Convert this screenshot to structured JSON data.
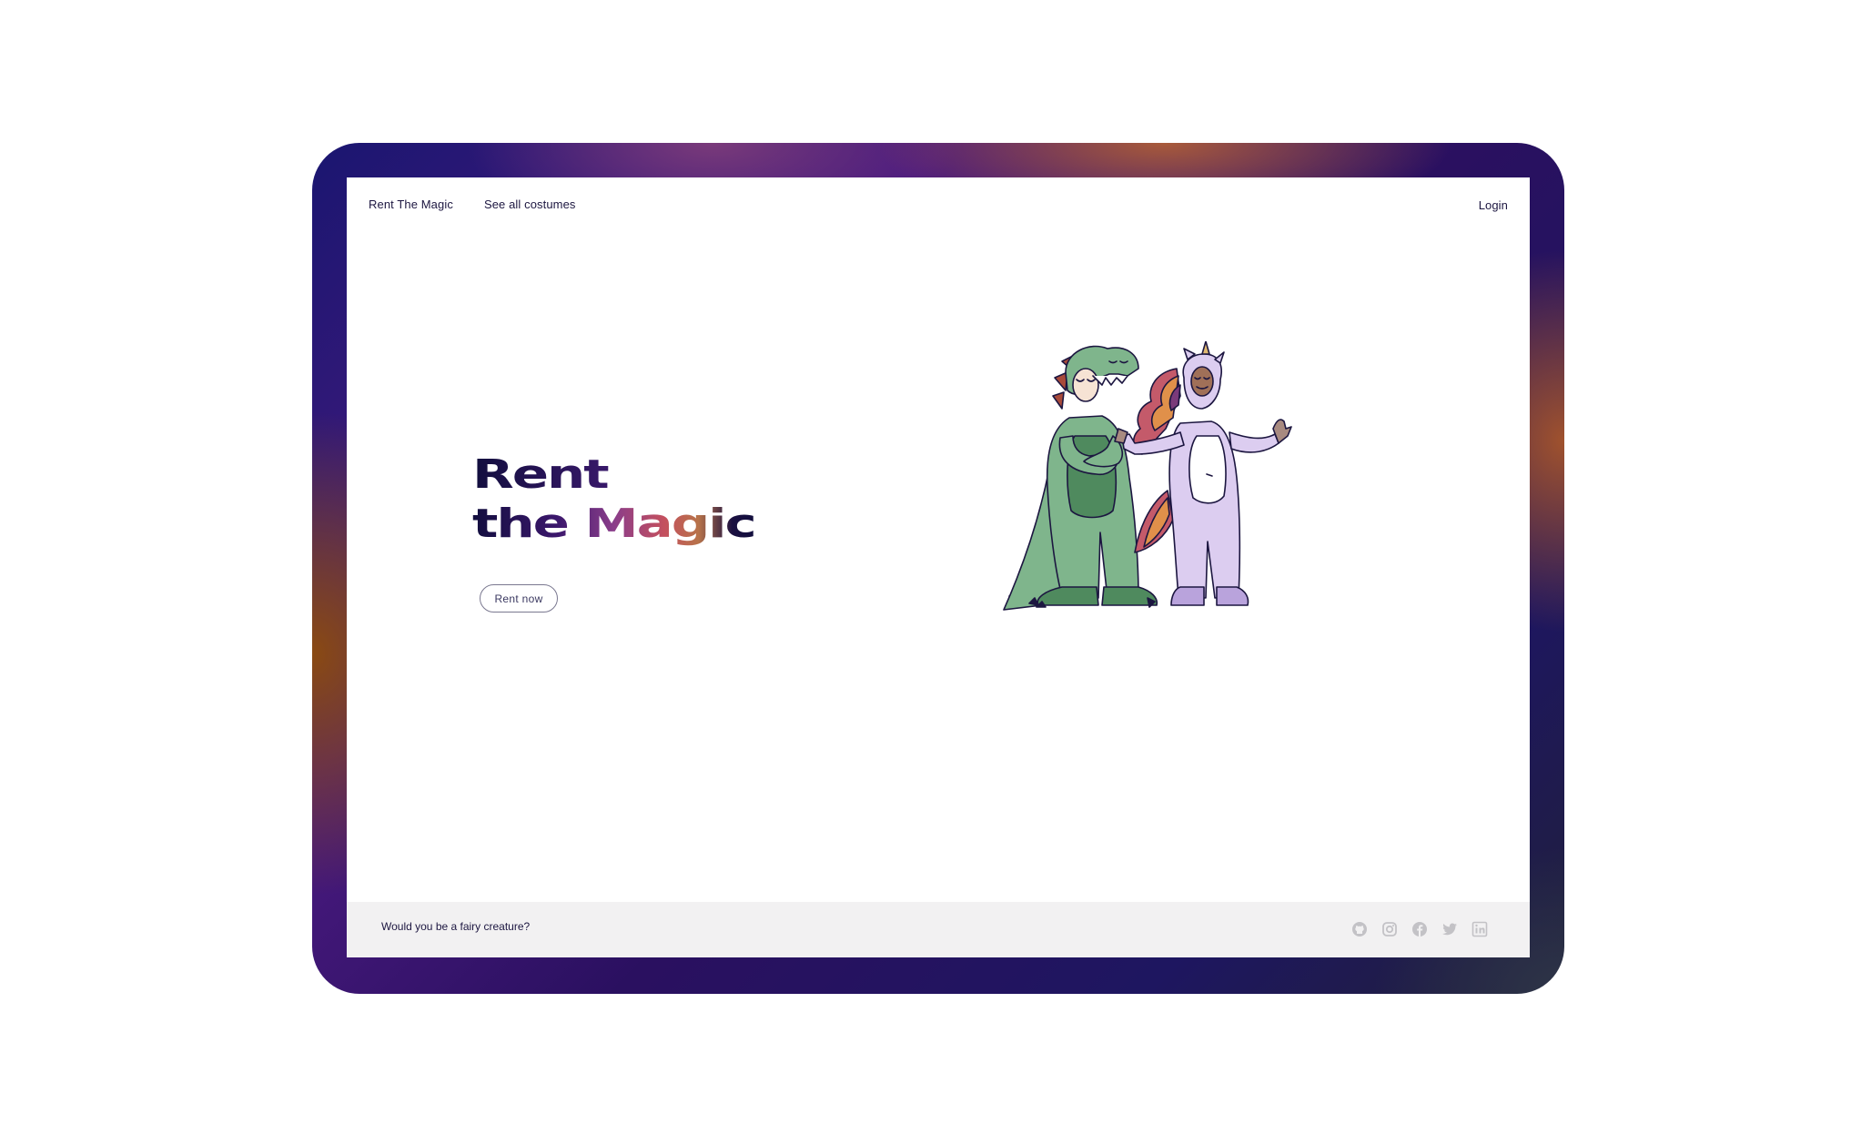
{
  "nav": {
    "brand": "Rent The Magic",
    "costumes_link": "See all costumes",
    "login": "Login"
  },
  "hero": {
    "line1": "Rent",
    "line2": "the Magic",
    "cta": "Rent now"
  },
  "footer": {
    "tagline": "Would you be a fairy creature?",
    "social_icons": [
      "github-icon",
      "instagram-icon",
      "facebook-icon",
      "twitter-icon",
      "linkedin-icon"
    ]
  },
  "colors": {
    "text_dark": "#1c1640",
    "dino_green": "#7fb58c",
    "dino_belly": "#4f8a5e",
    "dino_spikes": "#a84a3a",
    "unicorn_lilac": "#dccdf0",
    "unicorn_boots": "#b9a3dc",
    "footer_bg": "#f2f1f2",
    "social_icon": "#c3c2c6"
  }
}
